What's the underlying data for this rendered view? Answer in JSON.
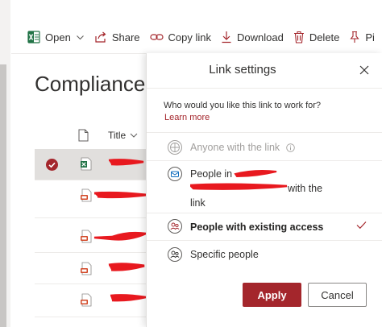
{
  "command_bar": {
    "open_label": "Open",
    "share_label": "Share",
    "copy_link_label": "Copy link",
    "download_label": "Download",
    "delete_label": "Delete",
    "pin_label": "Pi"
  },
  "library": {
    "title": "Compliance F",
    "title_column": "Title"
  },
  "panel": {
    "title": "Link settings",
    "question": "Who would you like this link to work for?",
    "learn_more": "Learn more",
    "options": [
      {
        "label": "Anyone with the link",
        "state": "disabled"
      },
      {
        "label_prefix": "People in",
        "label_suffix": "with the",
        "label_end": "link",
        "state": "enabled"
      },
      {
        "label": "People with existing access",
        "state": "selected"
      },
      {
        "label": "Specific people",
        "state": "enabled"
      }
    ],
    "apply_label": "Apply",
    "cancel_label": "Cancel"
  },
  "colors": {
    "accent": "#a4262c",
    "selected_row": "#e1dfdd",
    "redaction": "#e8191f",
    "excel_green": "#217346",
    "pdf_red": "#d24726"
  },
  "icons": [
    "excel-icon",
    "share-icon",
    "copy-link-icon",
    "download-icon",
    "delete-icon",
    "pin-icon",
    "document-icon",
    "globe-icon",
    "building-icon",
    "people-icon",
    "specific-people-icon",
    "close-icon",
    "checkmark-icon",
    "info-icon"
  ]
}
